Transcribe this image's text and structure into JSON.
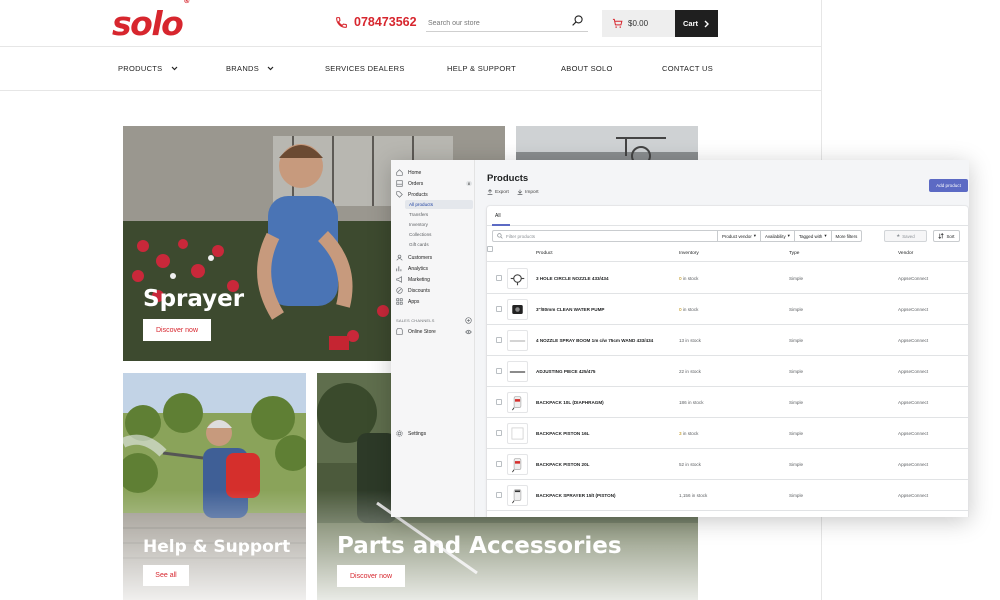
{
  "storefront": {
    "logo": "solo",
    "logo_mark": "®",
    "phone": "078473562",
    "search_placeholder": "Search our store",
    "cart_total": "$0.00",
    "cart_label": "Cart",
    "nav": [
      "PRODUCTS",
      "BRANDS",
      "SERVICES DEALERS",
      "HELP & SUPPORT",
      "ABOUT SOLO",
      "CONTACT US"
    ],
    "tiles": {
      "sprayer": {
        "title": "Sprayer",
        "button": "Discover now"
      },
      "help": {
        "title": "Help & Support",
        "button": "See all"
      },
      "parts": {
        "title": "Parts and Accessories",
        "button": "Discover now"
      }
    },
    "accent_color": "#d7262e"
  },
  "admin": {
    "sidebar": {
      "items": [
        "Home",
        "Orders",
        "Products"
      ],
      "orders_badge": "8",
      "sub_items": [
        "All products",
        "Transfers",
        "Inventory",
        "Collections",
        "Gift cards"
      ],
      "items2": [
        "Customers",
        "Analytics",
        "Marketing",
        "Discounts",
        "Apps"
      ],
      "sales_channels": "SALES CHANNELS",
      "online_store": "Online Store",
      "settings": "Settings"
    },
    "title": "Products",
    "export": "Export",
    "import": "Import",
    "add_product": "Add product",
    "tab_all": "All",
    "filter_placeholder": "Filter products",
    "filters": [
      "Product vendor",
      "Availability",
      "Tagged with",
      "More filters"
    ],
    "saved": "Saved",
    "sort": "Sort",
    "columns": [
      "Product",
      "Inventory",
      "Type",
      "Vendor"
    ],
    "rows": [
      {
        "name": "3 HOLE CIRCLE NOZZLE 433/434",
        "inventory_count": "0",
        "inventory_suffix": " in stock",
        "type": "Simple",
        "vendor": "AppseConnect"
      },
      {
        "name": "3\"/80mm CLEAN WATER PUMP",
        "inventory_count": "0",
        "inventory_suffix": " in stock",
        "type": "Simple",
        "vendor": "AppseConnect"
      },
      {
        "name": "4 NOZZLE SPRAY BOOM 1m c/w 75cm WAND 433/434",
        "inventory_count": "13",
        "inventory_suffix": " in stock",
        "type": "Simple",
        "vendor": "AppseConnect"
      },
      {
        "name": "ADJUSTING PIECE 425/475",
        "inventory_count": "22",
        "inventory_suffix": " in stock",
        "type": "Simple",
        "vendor": "AppseConnect"
      },
      {
        "name": "BACKPACK 10L (DIAPHRAGM)",
        "inventory_count": "186",
        "inventory_suffix": " in stock",
        "type": "Simple",
        "vendor": "AppseConnect"
      },
      {
        "name": "BACKPACK PISTON 16L",
        "inventory_count": "3",
        "inventory_suffix": " in stock",
        "type": "Simple",
        "vendor": "AppseConnect"
      },
      {
        "name": "BACKPACK PISTON 20L",
        "inventory_count": "52",
        "inventory_suffix": " in stock",
        "type": "Simple",
        "vendor": "AppseConnect"
      },
      {
        "name": "BACKPACK SPRAYER 15lt (PISTON)",
        "inventory_count": "1,156",
        "inventory_suffix": " in stock",
        "type": "Simple",
        "vendor": "AppseConnect"
      }
    ],
    "accent_color": "#5c6ac4"
  }
}
